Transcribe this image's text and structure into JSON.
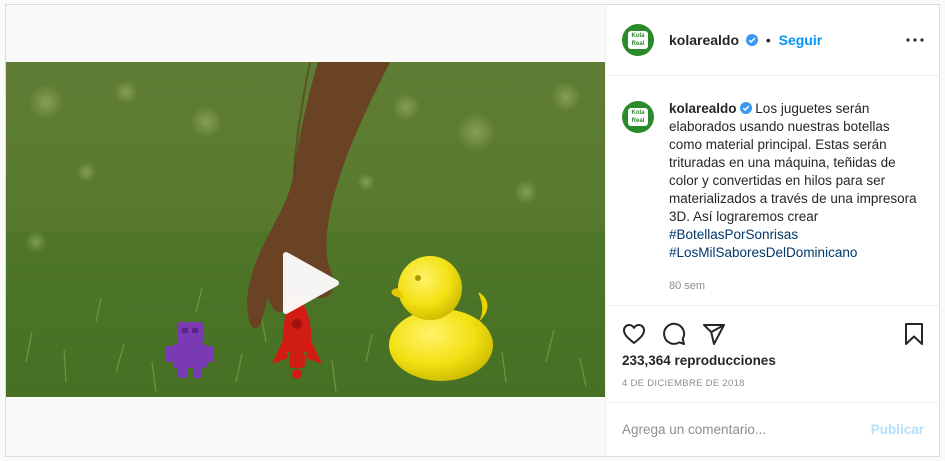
{
  "post": {
    "username": "kolarealdo",
    "avatar_text": "Kola Real",
    "follow_label": "Seguir",
    "separator": "•",
    "caption": "Los juguetes serán elaborados usando nuestras botellas como material principal. Estas serán trituradas en una máquina, teñidas de color y convertidas en hilos para ser materializados a través de una impresora 3D. Así lograremos crear",
    "hashtags": [
      "#BotellasPorSonrisas",
      "#LosMilSaboresDelDominicano"
    ],
    "age": "80 sem",
    "views": "233,364 reproducciones",
    "date": "4 de diciembre de 2018"
  },
  "comment": {
    "placeholder": "Agrega un comentario...",
    "publish_label": "Publicar"
  },
  "icons": {
    "like": "heart-icon",
    "comment": "comment-icon",
    "share": "paper-plane-icon",
    "save": "bookmark-icon",
    "more": "more-options-icon",
    "play": "play-icon",
    "verified": "verified-badge-icon"
  },
  "colors": {
    "accent": "#0095f6",
    "hashtag": "#00376b",
    "brand_green": "#2b8a2b",
    "muted": "#8e8e8e",
    "publish_disabled": "#b2dffc"
  }
}
